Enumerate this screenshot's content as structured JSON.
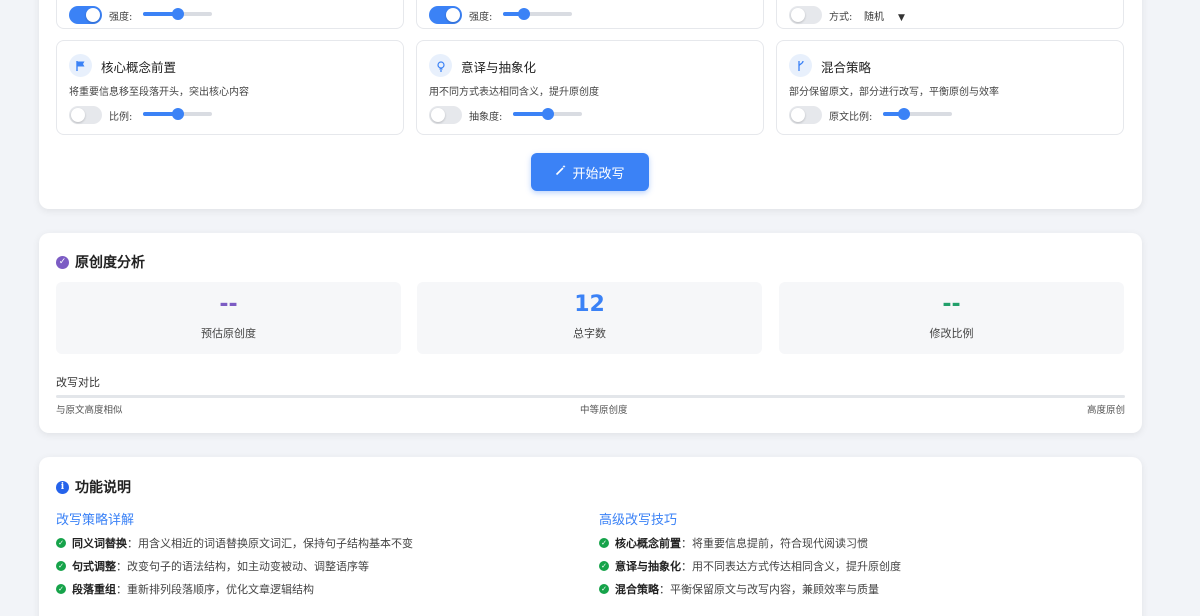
{
  "settings": {
    "row1": [
      {
        "label": "强度:",
        "toggle_on": true,
        "slider_value": 0.5
      },
      {
        "label": "强度:",
        "toggle_on": true,
        "slider_value": 0.3
      },
      {
        "label": "方式:",
        "toggle_on": false,
        "select_value": "随机"
      }
    ],
    "cards": [
      {
        "title": "核心概念前置",
        "desc": "将重要信息移至段落开头，突出核心内容",
        "icon": "flag-icon",
        "control_label": "比例:",
        "toggle_on": false,
        "slider_value": 0.5
      },
      {
        "title": "意译与抽象化",
        "desc": "用不同方式表达相同含义，提升原创度",
        "icon": "lightbulb-icon",
        "control_label": "抽象度:",
        "toggle_on": false,
        "slider_value": 0.5
      },
      {
        "title": "混合策略",
        "desc": "部分保留原文，部分进行改写，平衡原创与效率",
        "icon": "branch-icon",
        "control_label": "原文比例:",
        "toggle_on": false,
        "slider_value": 0.3
      }
    ],
    "start_button": "开始改写"
  },
  "analysis": {
    "title": "原创度分析",
    "stats": [
      {
        "value": "--",
        "label": "预估原创度",
        "color": "#7c5cc4"
      },
      {
        "value": "12",
        "label": "总字数",
        "color": "#3b82f6"
      },
      {
        "value": "--",
        "label": "修改比例",
        "color": "#22a06b"
      }
    ],
    "compare_title": "改写对比",
    "scale": {
      "left": "与原文高度相似",
      "middle": "中等原创度",
      "right": "高度原创"
    }
  },
  "help": {
    "title": "功能说明",
    "left": {
      "title": "改写策略详解",
      "items": [
        {
          "term": "同义词替换",
          "text": "：用含义相近的词语替换原文词汇，保持句子结构基本不变"
        },
        {
          "term": "句式调整",
          "text": "：改变句子的语法结构，如主动变被动、调整语序等"
        },
        {
          "term": "段落重组",
          "text": "：重新排列段落顺序，优化文章逻辑结构"
        }
      ]
    },
    "right": {
      "title": "高级改写技巧",
      "items": [
        {
          "term": "核心概念前置",
          "text": "：将重要信息提前，符合现代阅读习惯"
        },
        {
          "term": "意译与抽象化",
          "text": "：用不同表达方式传达相同含义，提升原创度"
        },
        {
          "term": "混合策略",
          "text": "：平衡保留原文与改写内容，兼顾效率与质量"
        }
      ]
    }
  }
}
